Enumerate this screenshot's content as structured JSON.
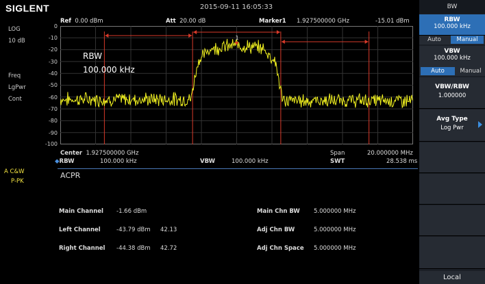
{
  "header": {
    "brand": "SIGLENT",
    "datetime": "2015-09-11   16:05:33",
    "ref_label": "Ref",
    "ref_value": "0.00 dBm",
    "att_label": "Att",
    "att_value": "20.00 dB",
    "marker_label": "Marker1",
    "marker_freq": "1.927500000  GHz",
    "marker_level": "-15.01 dBm"
  },
  "left_panel": {
    "scale": "LOG",
    "scale_div": "10 dB",
    "freq": "Freq",
    "lgpwr": "LgPwr",
    "cont": "Cont",
    "trace_mode": "A  C&W",
    "trace_detect": "P-PK"
  },
  "plot": {
    "y_ticks": [
      "0",
      "-10",
      "-20",
      "-30",
      "-40",
      "-50",
      "-60",
      "-70",
      "-80",
      "-90",
      "-100"
    ],
    "rbw_overlay_label": "RBW",
    "rbw_overlay_value": "100.000  kHz",
    "marker_number": "1",
    "colors": {
      "trace": "#f0f020",
      "channel_lines": "#d83a2a",
      "grid": "#3a3a3a"
    }
  },
  "chart_data": {
    "type": "line",
    "xlim": [
      1917500000,
      1937500000
    ],
    "ylim": [
      -100,
      0
    ],
    "xlabel": "",
    "ylabel": "",
    "main_channel": [
      1925000000,
      1930000000
    ],
    "left_channel": [
      1920000000,
      1925000000
    ],
    "right_channel": [
      1930000000,
      1935000000
    ],
    "series": [
      {
        "x": [
          1917500000,
          1924900000,
          1925300000,
          1926000000,
          1927500000,
          1929000000,
          1929700000,
          1930100000,
          1937500000
        ],
        "values": [
          -62,
          -62,
          -30,
          -19,
          -16,
          -19,
          -30,
          -63,
          -63
        ]
      }
    ]
  },
  "footer": {
    "center_label": "Center",
    "center_value": "1.927500000  GHz",
    "span_label": "Span",
    "span_value": "20.000000  MHz",
    "rbw_label": "RBW",
    "rbw_value": "100.000  kHz",
    "vbw_label": "VBW",
    "vbw_value": "100.000  kHz",
    "swt_label": "SWT",
    "swt_value": "28.538  ms"
  },
  "measurement": {
    "title": "ACPR",
    "main_label": "Main Channel",
    "main_value": "-1.66  dBm",
    "left_label": "Left Channel",
    "left_value": "-43.79  dBm",
    "left_dbc": "42.13",
    "right_label": "Right Channel",
    "right_value": "-44.38  dBm",
    "right_dbc": "42.72",
    "main_bw_label": "Main Chn BW",
    "main_bw_value": "5.000000   MHz",
    "adj_bw_label": "Adj Chn BW",
    "adj_bw_value": "5.000000   MHz",
    "adj_space_label": "Adj Chn Space",
    "adj_space_value": "5.000000   MHz"
  },
  "menu": {
    "title": "BW",
    "rbw_label": "RBW",
    "rbw_value": "100.000  kHz",
    "rbw_auto": "Auto",
    "rbw_manual": "Manual",
    "vbw_label": "VBW",
    "vbw_value": "100.000  kHz",
    "vbw_auto": "Auto",
    "vbw_manual": "Manual",
    "ratio_label": "VBW/RBW",
    "ratio_value": "1.000000",
    "avg_label": "Avg Type",
    "avg_value": "Log Pwr",
    "local": "Local"
  }
}
